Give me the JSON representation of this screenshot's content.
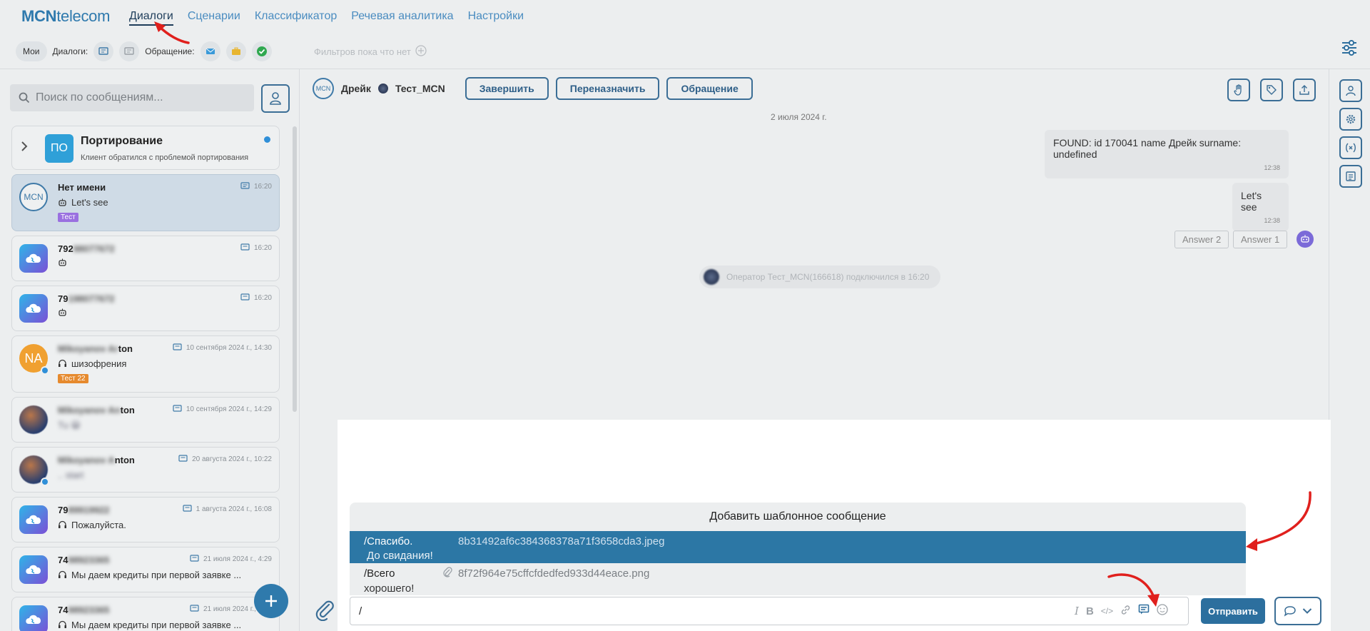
{
  "logo": {
    "brand": "MCN",
    "rest": "telecom"
  },
  "nav": [
    "Диалоги",
    "Сценарии",
    "Классификатор",
    "Речевая аналитика",
    "Настройки"
  ],
  "filters": {
    "mine": "Мои",
    "dialogs": "Диалоги:",
    "appeal": "Обращение:",
    "none": "Фильтров пока что нет"
  },
  "search": {
    "placeholder": "Поиск по сообщениям..."
  },
  "group": {
    "avatar": "ПО",
    "title": "Портирование",
    "subtitle": "Клиент обратился с проблемой портирования"
  },
  "dialogs": [
    {
      "name": "Нет имени",
      "time": "16:20",
      "msg": "Let's see",
      "tag": "Тест",
      "avatar": "MCN"
    },
    {
      "name": "792",
      "blur": "98077672",
      "time": "16:20",
      "msg": ""
    },
    {
      "name": "79",
      "blur": "198077672",
      "time": "16:20",
      "msg": ""
    },
    {
      "name": "",
      "blur": "Mikoyanov Ar",
      "name2": "ton",
      "time": "10 сентября 2024 г., 14:30",
      "msg": "шизофрения",
      "tag": "Тест 22",
      "avatar": "NA"
    },
    {
      "name": "",
      "blur": "Mikoyanov An",
      "name2": "ton",
      "time": "10 сентября 2024 г., 14:29",
      "msg": ""
    },
    {
      "name": "",
      "blur": "Mikoyanov A",
      "name2": "nton",
      "time": "20 августа 2024 г., 10:22",
      "msg": ""
    },
    {
      "name": "79",
      "blur": "89919922",
      "time": "1 августа 2024 г., 16:08",
      "msg": "Пожалуйста."
    },
    {
      "name": "74",
      "blur": "98923365",
      "time": "21 июля 2024 г., 4:29",
      "msg": "Мы даем кредиты при первой заявке ..."
    },
    {
      "name": "74",
      "blur": "98923365",
      "time": "21 июля 2024 г., 4:29",
      "msg": "Мы даем кредиты при первой заявке ..."
    }
  ],
  "chat": {
    "contact": "Дрейк",
    "operator": "Тест_MCN",
    "btn_finish": "Завершить",
    "btn_reassign": "Переназначить",
    "btn_appeal": "Обращение",
    "date": "2 июля 2024 г.",
    "msg1": {
      "text": "FOUND: id 170041 name Дрейк surname: undefined",
      "time": "12:38"
    },
    "msg2": {
      "text": "Let's see",
      "time": "12:38"
    },
    "answers": [
      "Answer 2",
      "Answer 1"
    ],
    "op_joined": "Оператор Тест_MCN(166618) подключился в 16:20"
  },
  "templates": {
    "title": "Добавить шаблонное сообщение",
    "items": [
      {
        "cmd": "/Спасибо.",
        "sub": "До свидания!",
        "file": "8b31492af6c384368378a71f3658cda3.jpeg"
      },
      {
        "cmd": "/Всего",
        "sub": "хорошего!",
        "file": "8f72f964e75cffcfdedfed933d44eace.png"
      }
    ]
  },
  "composer": {
    "value": "/",
    "send": "Отправить"
  }
}
